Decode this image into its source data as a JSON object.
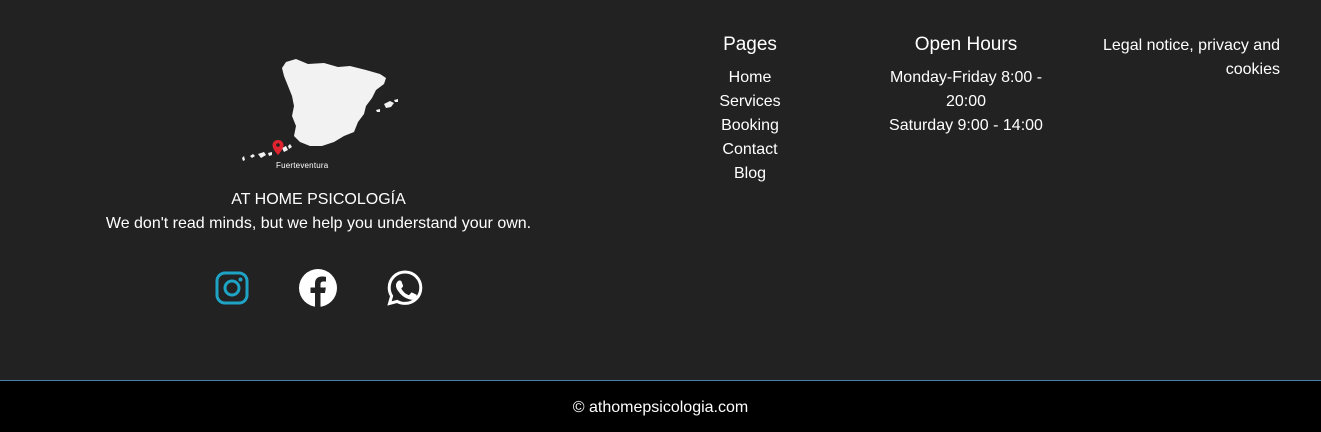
{
  "brand": {
    "map_caption": "Fuerteventura",
    "name": "AT HOME PSICOLOGÍA",
    "tagline": "We don't read minds, but we help you understand your own."
  },
  "social": {
    "instagram_icon": "instagram-icon",
    "facebook_icon": "facebook-icon",
    "whatsapp_icon": "whatsapp-icon",
    "instagram_color": "#1fa3c4",
    "facebook_color": "#ffffff",
    "whatsapp_color": "#ffffff"
  },
  "pages": {
    "title": "Pages",
    "items": [
      {
        "label": "Home"
      },
      {
        "label": "Services"
      },
      {
        "label": "Booking"
      },
      {
        "label": "Contact"
      },
      {
        "label": "Blog"
      }
    ]
  },
  "hours": {
    "title": "Open Hours",
    "weekday": "Monday-Friday 8:00 - 20:00",
    "saturday": "Saturday 9:00 - 14:00"
  },
  "legal": {
    "label": "Legal notice, privacy and cookies"
  },
  "footer": {
    "copyright": "© athomepsicologia.com"
  },
  "colors": {
    "background": "#222222",
    "bottom_bar": "#000000",
    "divider": "#4a7fa8",
    "map_pin": "#e0242f"
  }
}
